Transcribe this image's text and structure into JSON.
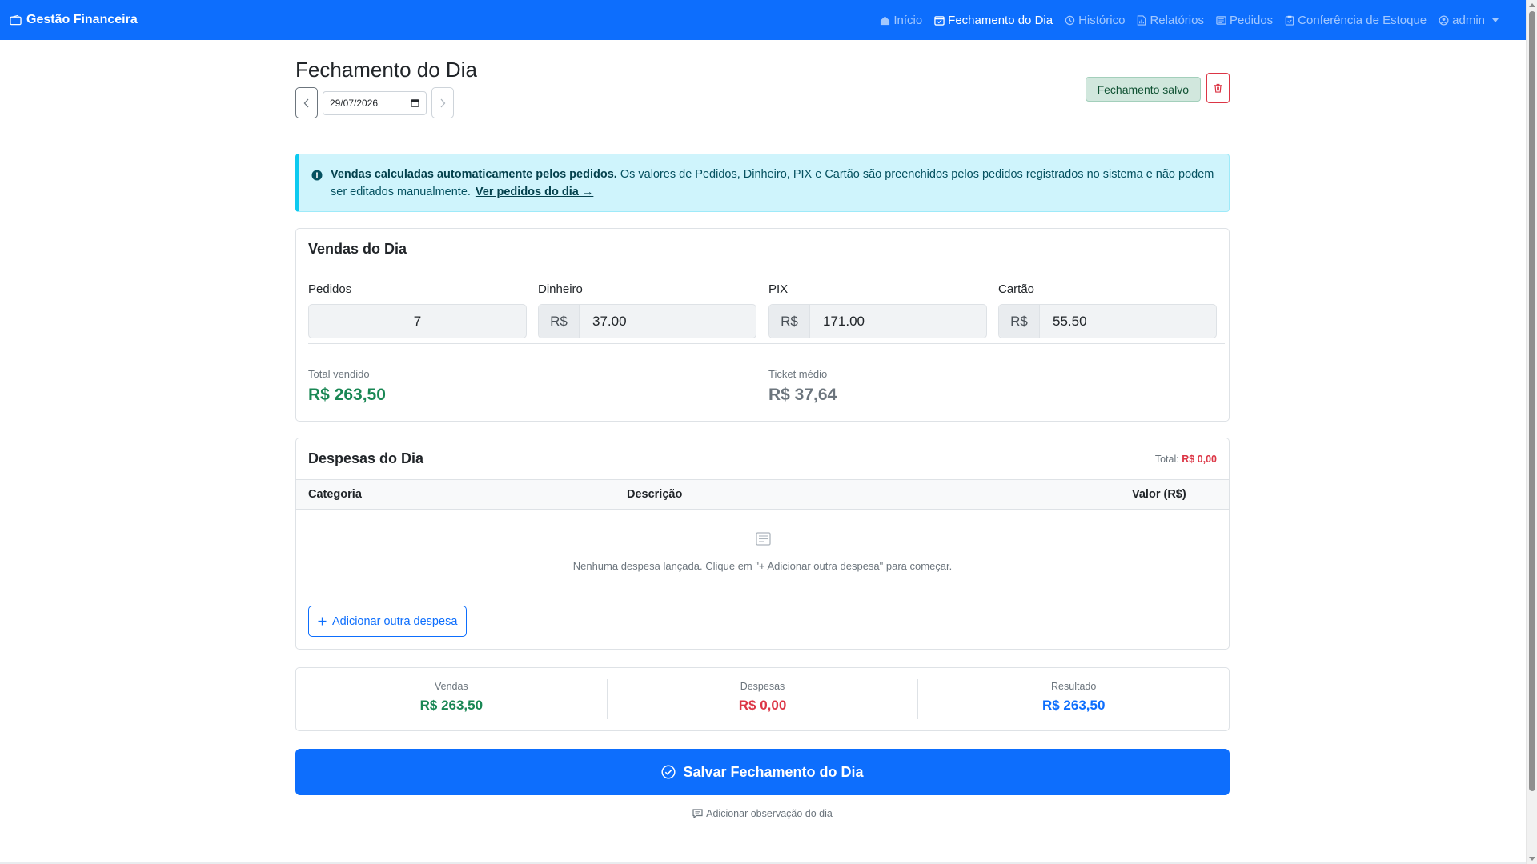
{
  "navbar": {
    "brand": "Gestão Financeira",
    "links": [
      {
        "label": "Início",
        "icon": "house-icon",
        "active": false
      },
      {
        "label": "Fechamento do Dia",
        "icon": "calendar-check-icon",
        "active": true
      },
      {
        "label": "Histórico",
        "icon": "clock-history-icon",
        "active": false
      },
      {
        "label": "Relatórios",
        "icon": "file-report-icon",
        "active": false
      },
      {
        "label": "Pedidos",
        "icon": "receipt-icon",
        "active": false
      },
      {
        "label": "Conferência de Estoque",
        "icon": "clipboard-check-icon",
        "active": false
      }
    ],
    "user": "admin"
  },
  "header": {
    "title": "Fechamento do Dia",
    "date": "29/07/2026",
    "status_badge": "Fechamento salvo"
  },
  "alert": {
    "bold": "Vendas calculadas automaticamente pelos pedidos.",
    "text": " Os valores de Pedidos, Dinheiro, PIX e Cartão são preenchidos pelos pedidos registrados no sistema e não podem ser editados manualmente.",
    "link": "Ver pedidos do dia →"
  },
  "vendas": {
    "title": "Vendas do Dia",
    "fields": {
      "pedidos": {
        "label": "Pedidos",
        "value": "7"
      },
      "dinheiro": {
        "label": "Dinheiro",
        "prefix": "R$",
        "value": "37.00"
      },
      "pix": {
        "label": "PIX",
        "prefix": "R$",
        "value": "171.00"
      },
      "cartao": {
        "label": "Cartão",
        "prefix": "R$",
        "value": "55.50"
      }
    },
    "total_label": "Total vendido",
    "total_value": "R$ 263,50",
    "ticket_label": "Ticket médio",
    "ticket_value": "R$ 37,64"
  },
  "despesas": {
    "title": "Despesas do Dia",
    "total_label": "Total:",
    "total_value": "R$ 0,00",
    "columns": [
      "Categoria",
      "Descrição",
      "Valor (R$)"
    ],
    "empty_text": "Nenhuma despesa lançada. Clique em \"+ Adicionar outra despesa\" para começar.",
    "add_button": "Adicionar outra despesa"
  },
  "summary": [
    {
      "label": "Vendas",
      "value": "R$ 263,50",
      "color": "#198754"
    },
    {
      "label": "Despesas",
      "value": "R$ 0,00",
      "color": "#dc3545"
    },
    {
      "label": "Resultado",
      "value": "R$ 263,50",
      "color": "#0d6efd"
    }
  ],
  "actions": {
    "save": "Salvar Fechamento do Dia",
    "observation": "Adicionar observação do dia"
  },
  "colors": {
    "primary": "#0d6efd",
    "success": "#198754",
    "danger": "#dc3545",
    "info_bg": "#cff4fc"
  }
}
